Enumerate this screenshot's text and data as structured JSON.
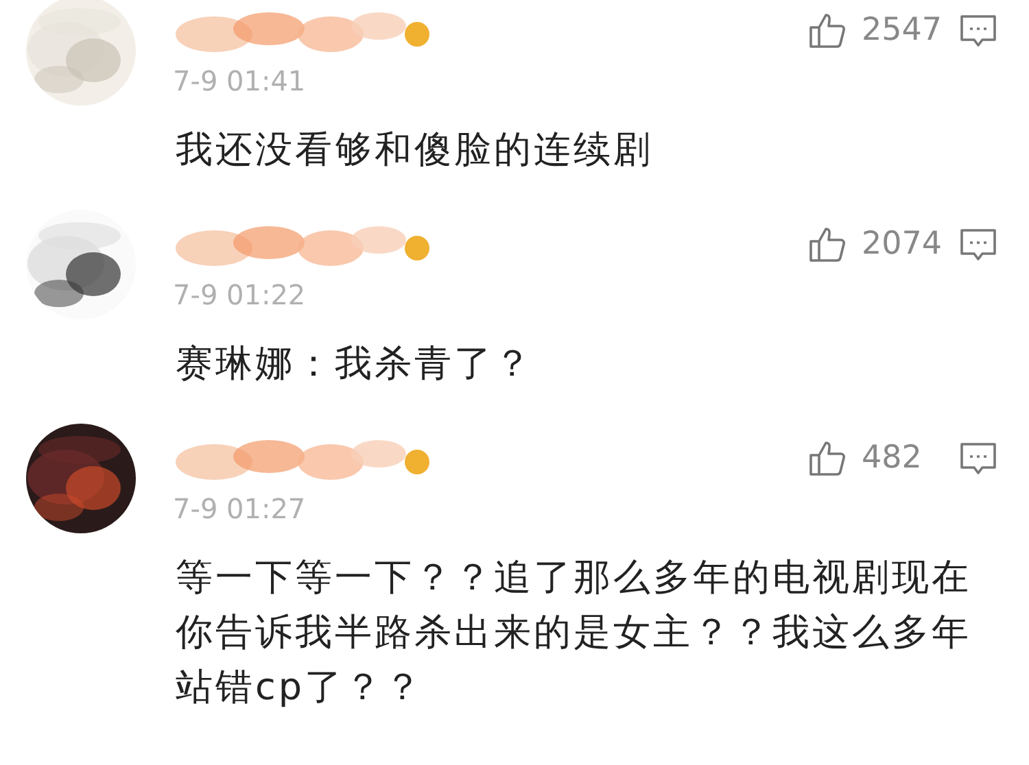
{
  "comments": [
    {
      "time": "7-9 01:41",
      "likes": "2547",
      "text": "我还没看够和傻脸的连续剧"
    },
    {
      "time": "7-9 01:22",
      "likes": "2074",
      "text": "赛琳娜：我杀青了？"
    },
    {
      "time": "7-9 01:27",
      "likes": "482",
      "text": "等一下等一下？？追了那么多年的电视剧现在你告诉我半路杀出来的是女主？？我这么多年站错cp了？？"
    }
  ]
}
